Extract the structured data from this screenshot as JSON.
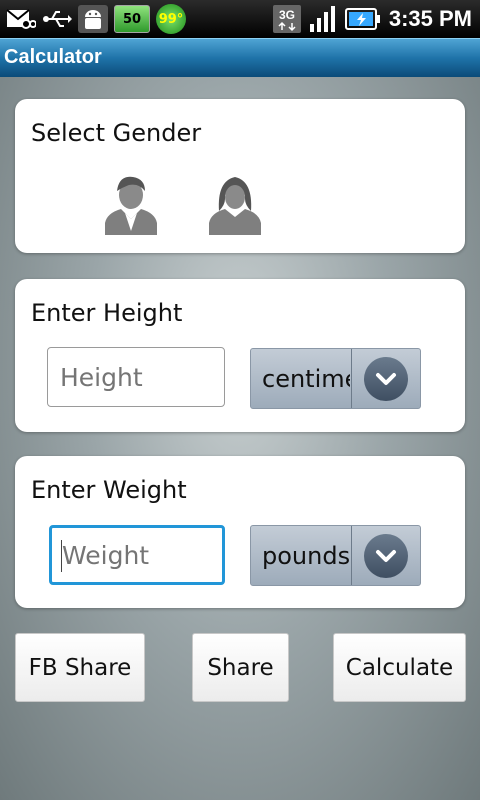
{
  "status_bar": {
    "battery_percent": "50",
    "temperature": "99°",
    "network": "3G",
    "time": "3:35 PM"
  },
  "app": {
    "title": "Calculator"
  },
  "gender_card": {
    "title": "Select Gender",
    "options": [
      "male-avatar-icon",
      "female-avatar-icon"
    ]
  },
  "height_card": {
    "title": "Enter Height",
    "input_placeholder": "Height",
    "unit_selected": "centimeters"
  },
  "weight_card": {
    "title": "Enter Weight",
    "input_placeholder": "Weight",
    "unit_selected": "pounds"
  },
  "buttons": {
    "fb_share": "FB Share",
    "share": "Share",
    "calculate": "Calculate"
  },
  "colors": {
    "title_bar": "#1f73a9",
    "focus": "#2196d8"
  }
}
